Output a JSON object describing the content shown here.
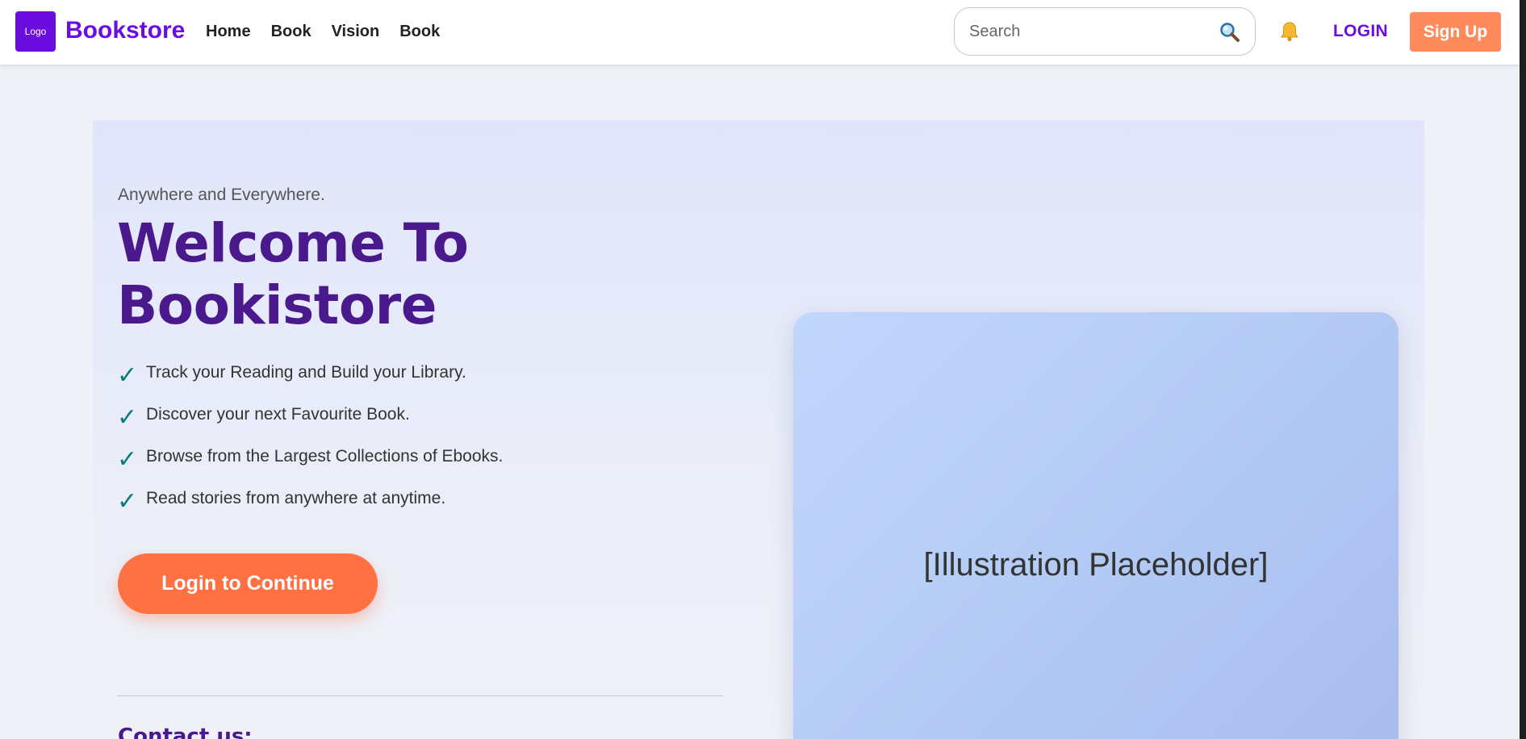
{
  "nav": {
    "logo_text": "Logo",
    "brand": "Bookstore",
    "links": [
      "Home",
      "Book",
      "Vision",
      "Book"
    ],
    "search_placeholder": "Search",
    "login_label": "LOGIN",
    "signup_label": "Sign Up",
    "icons": {
      "search": "search-icon",
      "notifications": "bell-icon"
    }
  },
  "hero": {
    "tagline": "Anywhere and Everywhere.",
    "title": "Welcome To Bookistore",
    "features": [
      "Track your Reading and Build your Library.",
      "Discover your next Favourite Book.",
      "Browse from the Largest Collections of Ebooks.",
      "Read stories from anywhere at anytime."
    ],
    "check_glyph": "✓",
    "cta_label": "Login to Continue",
    "contact_heading": "Contact us:",
    "illustration_label": "[Illustration Placeholder]"
  },
  "colors": {
    "brand": "#6a0dde",
    "title": "#4a1a8c",
    "cta": "#ff7043",
    "signup": "#ff8a5b",
    "check": "#0e7a77"
  }
}
